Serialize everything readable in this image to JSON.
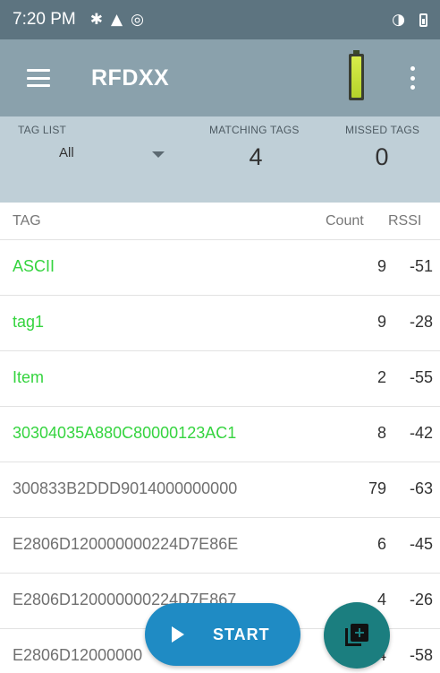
{
  "status_bar": {
    "time": "7:20 PM",
    "left_icons": [
      "settings-icon",
      "warning-icon",
      "sync-icon"
    ],
    "right_icons": [
      "vibrate-icon",
      "battery-icon"
    ]
  },
  "app_bar": {
    "title": "RFDXX",
    "menu_icon": "hamburger-menu-icon",
    "overflow_icon": "more-vert-icon",
    "reader_battery_level": 1.0
  },
  "summary": {
    "tag_list_label": "TAG LIST",
    "tag_list_value": "All",
    "matching_label": "MATCHING TAGS",
    "matching_value": "4",
    "missed_label": "MISSED TAGS",
    "missed_value": "0"
  },
  "table": {
    "headers": {
      "tag": "TAG",
      "count": "Count",
      "rssi": "RSSI"
    },
    "rows": [
      {
        "tag": "ASCII",
        "count": "9",
        "rssi": "-51",
        "matched": true
      },
      {
        "tag": "tag1",
        "count": "9",
        "rssi": "-28",
        "matched": true
      },
      {
        "tag": "Item",
        "count": "2",
        "rssi": "-55",
        "matched": true
      },
      {
        "tag": "30304035A880C80000123AC1",
        "count": "8",
        "rssi": "-42",
        "matched": true
      },
      {
        "tag": "300833B2DDD9014000000000",
        "count": "79",
        "rssi": "-63",
        "matched": false
      },
      {
        "tag": "E2806D120000000224D7E86E",
        "count": "6",
        "rssi": "-45",
        "matched": false
      },
      {
        "tag": "E2806D120000000224D7E867",
        "count": "4",
        "rssi": "-26",
        "matched": false
      },
      {
        "tag": "E2806D12000000",
        "count": "4",
        "rssi": "-58",
        "matched": false
      }
    ]
  },
  "actions": {
    "start_label": "START",
    "start_icon": "play-icon",
    "fab_icon": "library-add-icon"
  },
  "colors": {
    "status_bar": "#5d7480",
    "app_bar": "#8aa1ac",
    "summary_bg": "#bfcfd7",
    "matched_tag": "#35d43f",
    "unmatched_tag": "#707070",
    "start_button": "#1f8bc4",
    "fab": "#1b7e7f"
  }
}
